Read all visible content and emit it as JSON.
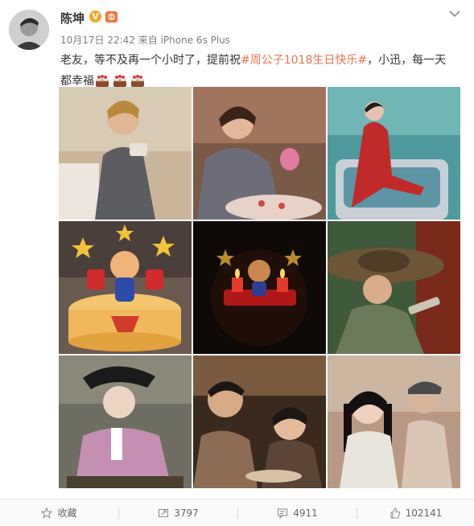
{
  "post": {
    "author": "陈坤",
    "verified_badge": "V",
    "meta_time": "10月17日 22:42",
    "meta_from": "来自",
    "meta_device": "iPhone 6s Plus",
    "text_before": "老友，等不及再一个小时了，提前祝",
    "hashtag": "#周公子1018生日快乐#",
    "text_after": "，小迅，每一天都幸福"
  },
  "icons": {
    "avatar": "avatar-photo",
    "level": "vip-level-icon",
    "menu": "chevron-down-icon",
    "cake": "cake-emoji-icon"
  },
  "colors": {
    "accent_link": "#eb7350",
    "verified": "#f5a623",
    "muted": "#808080"
  },
  "photos": [
    {
      "name": "photo-1"
    },
    {
      "name": "photo-2"
    },
    {
      "name": "photo-3"
    },
    {
      "name": "photo-4"
    },
    {
      "name": "photo-5"
    },
    {
      "name": "photo-6"
    },
    {
      "name": "photo-7"
    },
    {
      "name": "photo-8"
    },
    {
      "name": "photo-9"
    }
  ],
  "actions": {
    "favorite": "收藏",
    "repost": "3797",
    "comment": "4911",
    "like": "102141"
  }
}
